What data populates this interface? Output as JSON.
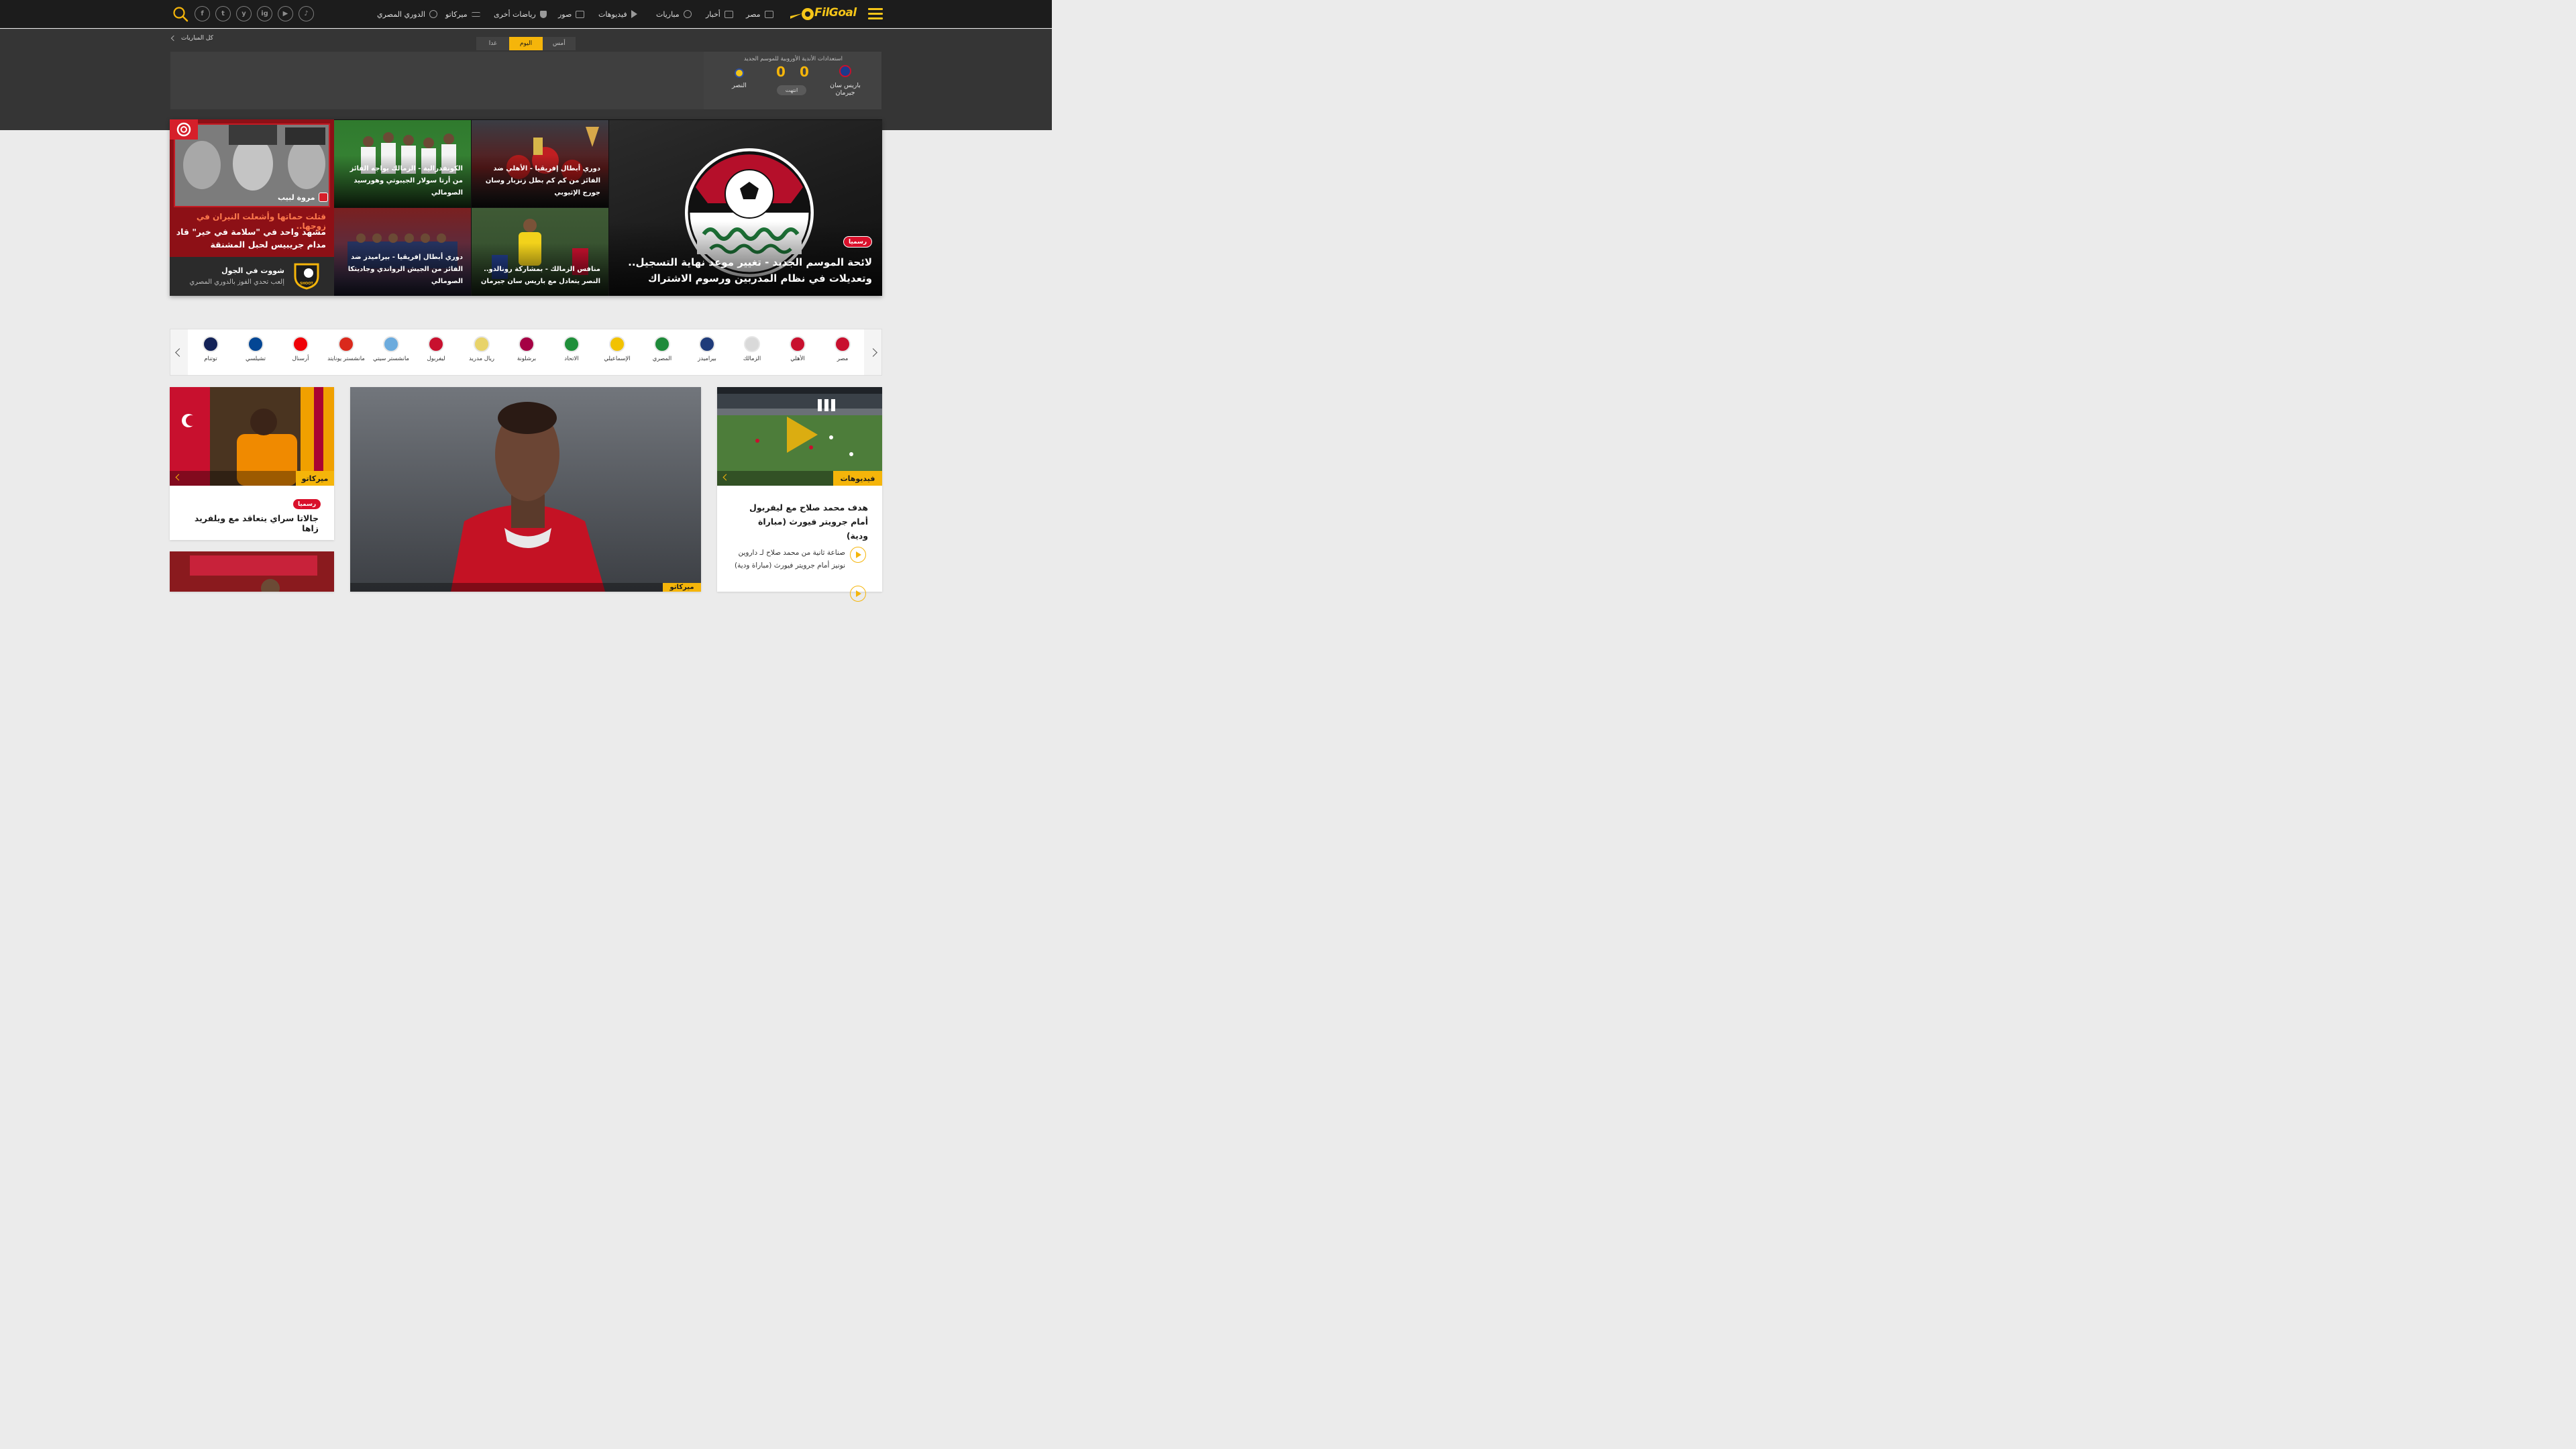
{
  "nav": {
    "logo": "FilGoal",
    "items": [
      {
        "label": "مصر",
        "icon": "news-icon"
      },
      {
        "label": "أخبار",
        "icon": "newspaper-icon"
      },
      {
        "label": "مباريات",
        "icon": "football-icon"
      },
      {
        "label": "فيديوهات",
        "icon": "play-icon"
      },
      {
        "label": "صور",
        "icon": "camera-icon"
      },
      {
        "label": "رياضات أخرى",
        "icon": "shield-icon"
      },
      {
        "label": "ميركاتو",
        "icon": "transfer-icon"
      },
      {
        "label": "الدوري المصري",
        "icon": "football-icon"
      }
    ],
    "social": [
      "f",
      "t",
      "y",
      "ig",
      "▶",
      "♪"
    ]
  },
  "matches": {
    "all_matches": "كل المباريات",
    "tabs": {
      "yesterday": "أمس",
      "today": "اليوم",
      "tomorrow": "غدا"
    },
    "competition": "استعدادات الأندية الأوروبية للموسم الجديد",
    "home_team": "باريس سان جيرمان",
    "away_team": "النصر",
    "home_score": "0",
    "away_score": "0",
    "status": "انتهت"
  },
  "hero": {
    "main_badge": "رسميا",
    "main_title": "لائحة الموسم الجديد - تغيير موعد نهاية التسجيل.. وتعديلات في نظام المدربين ورسوم الاشتراك",
    "tiles": [
      {
        "title": "دوري أبطال إفريقيا - الأهلي ضد الفائز من كم كم بطل زنزبار وسان جورج الإثيوبي"
      },
      {
        "title": "الكونفدرالية - الزمالك يواجه الفائز من أرتا سولار الجيبوتي وهورسيد الصومالي"
      },
      {
        "title": "منافس الزمالك - بمشاركة رونالدو.. النصر يتعادل مع باريس سان جيرمان"
      },
      {
        "title": "دوري أبطال إفريقيا - بيراميدز ضد الفائز من الجيش الرواندي وجاديتكا الصومالي"
      }
    ],
    "ad": {
      "author": "مروة لبيب",
      "line1": "قتلت حماتها وأشعلت النيران في زوجها..",
      "line2": "مشهد واحد في \"سلامة في خير\" قاد مدام جريبيس لحبل المشنقة",
      "promo_title": "شووت في الجول",
      "promo_sub": "إلعب تحدي الفوز بالدوري المصري"
    }
  },
  "teams": [
    {
      "name": "مصر",
      "color": "#c8102e"
    },
    {
      "name": "الأهلي",
      "color": "#c8102e"
    },
    {
      "name": "الزمالك",
      "color": "#d9d9d9"
    },
    {
      "name": "بيراميدز",
      "color": "#1f3b7a"
    },
    {
      "name": "المصري",
      "color": "#1e8a3a"
    },
    {
      "name": "الإسماعيلي",
      "color": "#f2c200"
    },
    {
      "name": "الاتحاد",
      "color": "#1f8f3a"
    },
    {
      "name": "برشلونة",
      "color": "#a50044"
    },
    {
      "name": "ريال مدريد",
      "color": "#e8d36a"
    },
    {
      "name": "ليفربول",
      "color": "#c8102e"
    },
    {
      "name": "مانشستر سيتي",
      "color": "#6cabdd"
    },
    {
      "name": "مانشستر يونايتد",
      "color": "#da291c"
    },
    {
      "name": "أرسنال",
      "color": "#ef0107"
    },
    {
      "name": "تشيلسي",
      "color": "#034694"
    },
    {
      "name": "توتنام",
      "color": "#132257"
    }
  ],
  "cards": {
    "mercato_left": {
      "tag": "ميركاتو",
      "badge": "رسميا",
      "title": "جالاتا سراي يتعاقد مع ويلفريد زاها"
    },
    "mercato_center": {
      "tag": "ميركاتو"
    },
    "videos": {
      "tag": "فيديوهات",
      "title": "هدف محمد صلاح مع ليفربول أمام جرويتر فيورث (مباراة ودية)",
      "item1": "صناعة ثانية من محمد صلاح لـ داروين نونيز أمام جرويتر فيورث (مباراة ودية)"
    }
  },
  "colors": {
    "accent": "#f5b50a",
    "dark": "#1c1c1c",
    "badge_red": "#d9102b"
  }
}
